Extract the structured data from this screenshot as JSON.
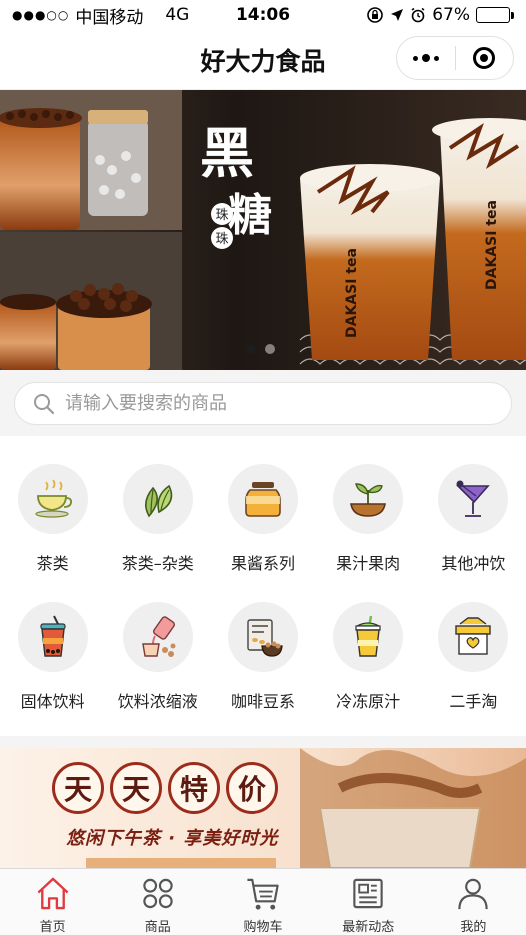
{
  "status_bar": {
    "signal": "●●●○○",
    "carrier": "中国移动",
    "network": "4G",
    "time": "14:06",
    "battery_percent": "67%",
    "battery_level": 0.67
  },
  "nav": {
    "title": "好大力食品"
  },
  "banner": {
    "title_big": "黑糖",
    "title_sub": "珠珠",
    "brand": "DAKASI tea",
    "slide_count": 2,
    "active_slide": 0
  },
  "search": {
    "placeholder": "请输入要搜索的商品"
  },
  "categories": [
    {
      "label": "茶类",
      "icon": "tea-cup-icon"
    },
    {
      "label": "茶类–杂类",
      "icon": "tea-leaves-icon"
    },
    {
      "label": "果酱系列",
      "icon": "jam-jar-icon"
    },
    {
      "label": "果汁果肉",
      "icon": "sprout-bowl-icon"
    },
    {
      "label": "其他冲饮",
      "icon": "cocktail-icon"
    },
    {
      "label": "固体饮料",
      "icon": "boba-cup-icon"
    },
    {
      "label": "饮料浓缩液",
      "icon": "syrup-pour-icon"
    },
    {
      "label": "咖啡豆系",
      "icon": "coffee-beans-icon"
    },
    {
      "label": "冷冻原汁",
      "icon": "juice-cup-icon"
    },
    {
      "label": "二手淘",
      "icon": "gift-box-icon"
    }
  ],
  "promo": {
    "chars": [
      "天",
      "天",
      "特",
      "价"
    ],
    "slogan": "悠闲下午茶 · 享美好时光"
  },
  "tabs": [
    {
      "label": "首页",
      "icon": "home-icon",
      "active": true
    },
    {
      "label": "商品",
      "icon": "grid-icon",
      "active": false
    },
    {
      "label": "购物车",
      "icon": "cart-icon",
      "active": false
    },
    {
      "label": "最新动态",
      "icon": "news-icon",
      "active": false
    },
    {
      "label": "我的",
      "icon": "profile-icon",
      "active": false
    }
  ],
  "colors": {
    "accent": "#e0393e",
    "banner_bg": "#2b211b",
    "promo_red": "#9c2b1c",
    "icon_circle": "#efefef"
  }
}
